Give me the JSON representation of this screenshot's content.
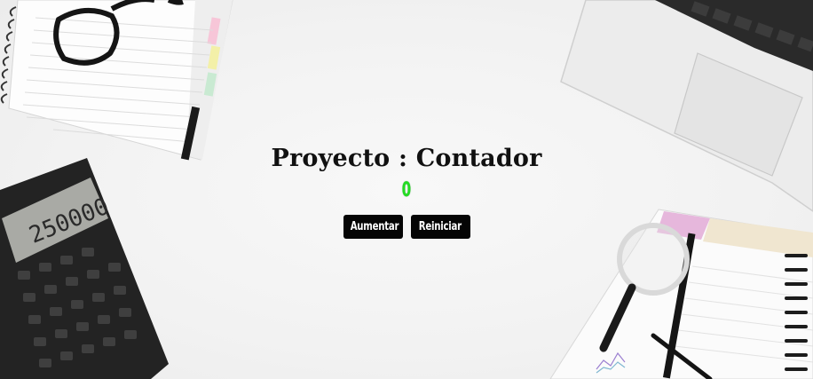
{
  "app": {
    "title": "Proyecto : Contador",
    "counter_value": "0",
    "counter_color": "#22dd22"
  },
  "controls": {
    "increment_label": "Aumentar",
    "reset_label": "Reiniciar"
  },
  "decor": {
    "desk_items": [
      "notebook-icon",
      "glasses-icon",
      "laptop-icon",
      "calculator-icon",
      "planner-icon",
      "magnifier-icon",
      "pen-icon"
    ],
    "calculator_display": "250000"
  }
}
